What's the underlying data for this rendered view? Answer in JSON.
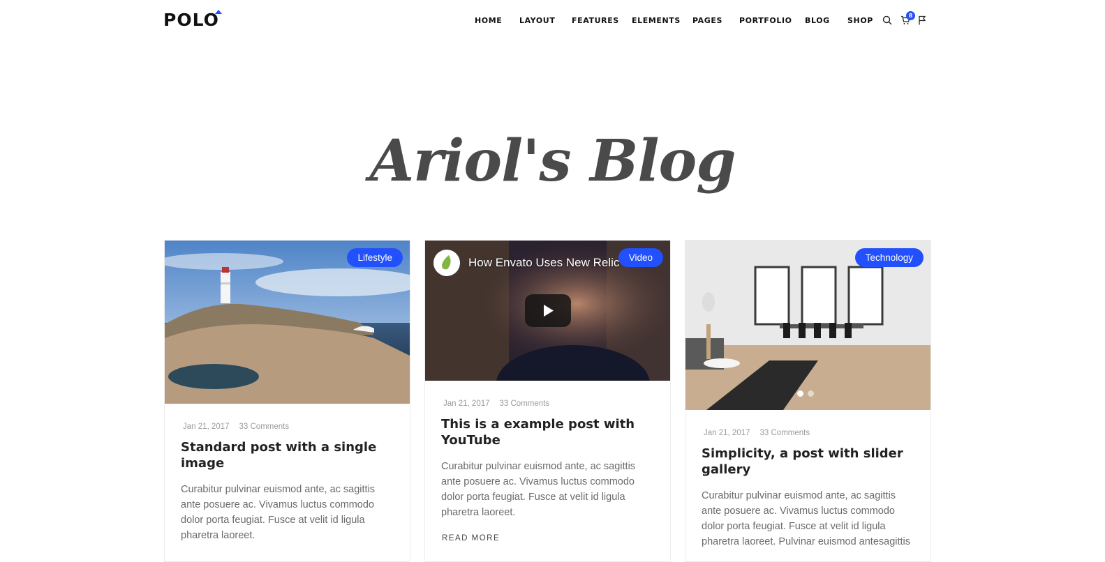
{
  "header": {
    "logo": "POLO",
    "nav": [
      "HOME",
      "LAYOUT",
      "FEATURES",
      "ELEMENTS",
      "PAGES",
      "PORTFOLIO",
      "BLOG",
      "SHOP"
    ],
    "cart_count": "8",
    "icons": [
      "search-icon",
      "cart-icon",
      "flag-icon"
    ]
  },
  "hero": {
    "title": "Ariol's Blog"
  },
  "colors": {
    "accent": "#2250fc",
    "text": "#222222",
    "muted": "#6a6a6a"
  },
  "posts": [
    {
      "category": "Lifestyle",
      "date": "Jan 21, 2017",
      "comments": "33 Comments",
      "title": "Standard post with a single image",
      "excerpt": "Curabitur pulvinar euismod ante, ac sagittis ante posuere ac. Vivamus luctus commodo dolor porta feugiat. Fusce at velit id ligula pharetra laoreet.",
      "media": "image"
    },
    {
      "category": "Video",
      "date": "Jan 21, 2017",
      "comments": "33 Comments",
      "title": "This is a example post with YouTube",
      "excerpt": "Curabitur pulvinar euismod ante, ac sagittis ante posuere ac. Vivamus luctus commodo dolor porta feugiat. Fusce at velit id ligula pharetra laoreet.",
      "read_more": "READ MORE",
      "video_title": "How Envato Uses New Relic",
      "media": "video"
    },
    {
      "category": "Technology",
      "date": "Jan 21, 2017",
      "comments": "33 Comments",
      "title": "Simplicity, a post with slider gallery",
      "excerpt": "Curabitur pulvinar euismod ante, ac sagittis ante posuere ac. Vivamus luctus commodo dolor porta feugiat. Fusce at velit id ligula pharetra laoreet. Pulvinar euismod antesagittis",
      "media": "slider"
    }
  ]
}
